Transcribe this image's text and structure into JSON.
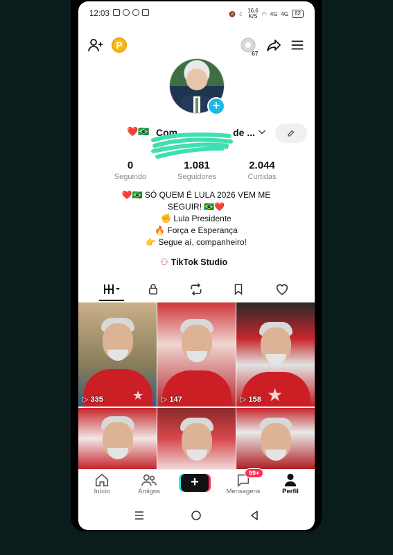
{
  "status_bar": {
    "time": "12:03",
    "net_speed": "16,6",
    "net_unit": "K/S",
    "sig1": "4G",
    "sig2": "4G",
    "battery": "62"
  },
  "top_bar": {
    "coin_label": "P",
    "notifications_count": "67"
  },
  "profile": {
    "name_visible": "Com",
    "name_tail": "de ...",
    "handle_prefix": "@c",
    "handle_tail": "de lu",
    "stats": [
      {
        "value": "0",
        "label": "Seguindo"
      },
      {
        "value": "1.081",
        "label": "Seguidores"
      },
      {
        "value": "2.044",
        "label": "Curtidas"
      }
    ],
    "bio_lines": [
      "❤️🇧🇷 SÓ QUEM É LULA 2026 VEM ME",
      "SEGUIR! 🇧🇷❤️",
      "✊ Lula Presidente",
      "🔥 Força e Esperança",
      "👉 Segue aí, companheiro!"
    ],
    "studio_label": "TikTok Studio"
  },
  "videos": [
    {
      "views": "335"
    },
    {
      "views": "147"
    },
    {
      "views": "158"
    },
    {
      "views": ""
    },
    {
      "views": ""
    },
    {
      "views": ""
    }
  ],
  "bottom_nav": {
    "home": "Início",
    "friends": "Amigos",
    "create": "+",
    "inbox": "Mensagens",
    "inbox_badge": "99+",
    "profile": "Perfil"
  },
  "colors": {
    "accent_red": "#ff2d55",
    "accent_cyan": "#2ee6e8",
    "coin": "#f7b91b",
    "shirt_red": "#cc1f25"
  }
}
